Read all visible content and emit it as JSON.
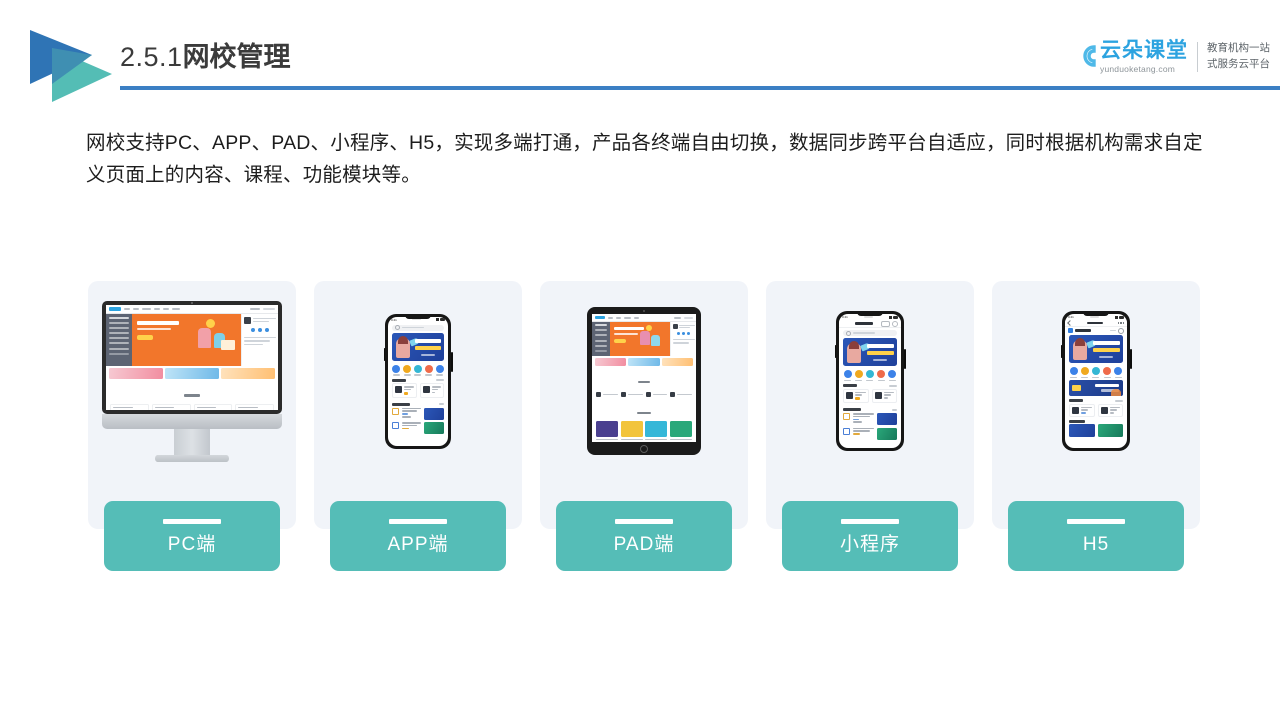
{
  "header": {
    "title_number": "2.5.1",
    "title_main": "网校管理",
    "rule_color": "#3b7fc4",
    "logo_blue": "#2f74b5",
    "logo_teal": "#54bdb5"
  },
  "brand": {
    "name_cn": "云朵课堂",
    "name_en": "yunduoketang.com",
    "tagline_line1": "教育机构一站",
    "tagline_line2": "式服务云平台",
    "accent": "#2ca3e0"
  },
  "body": {
    "paragraph": "网校支持PC、APP、PAD、小程序、H5，实现多端打通，产品各终端自由切换，数据同步跨平台自适应，同时根据机构需求自定义页面上的内容、课程、功能模块等。"
  },
  "cards": [
    {
      "label": "PC端",
      "device": "desktop-monitor",
      "card_bg": "#f1f4f9",
      "button_color": "#55bdb7"
    },
    {
      "label": "APP端",
      "device": "smartphone",
      "card_bg": "#f1f4f9",
      "button_color": "#55bdb7"
    },
    {
      "label": "PAD端",
      "device": "tablet",
      "card_bg": "#f1f4f9",
      "button_color": "#55bdb7"
    },
    {
      "label": "小程序",
      "device": "smartphone",
      "card_bg": "#f1f4f9",
      "button_color": "#55bdb7"
    },
    {
      "label": "H5",
      "device": "smartphone",
      "card_bg": "#f1f4f9",
      "button_color": "#55bdb7"
    }
  ]
}
